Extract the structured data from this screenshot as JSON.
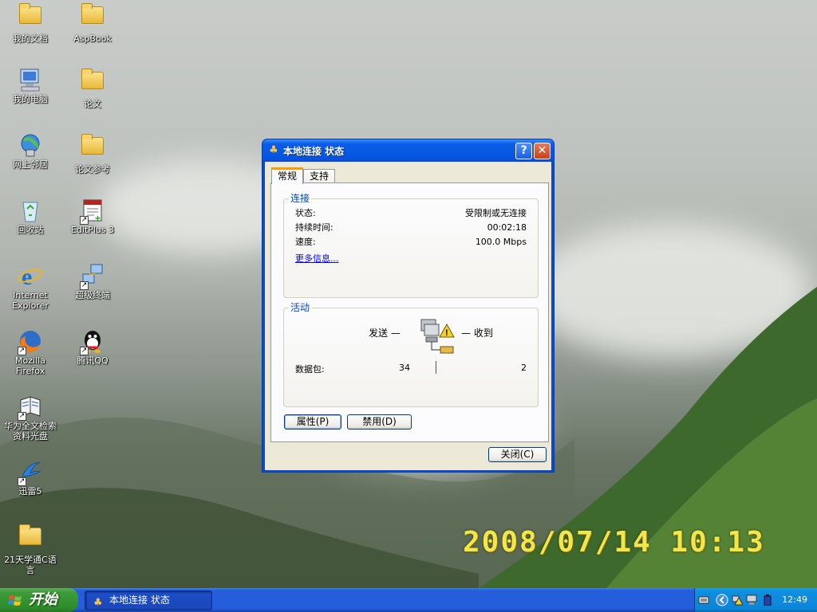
{
  "desktop": {
    "icons": [
      {
        "label": "我的文档",
        "icon": "my-documents-icon"
      },
      {
        "label": "AspBook",
        "icon": "folder-icon"
      },
      {
        "label": "我的电脑",
        "icon": "my-computer-icon"
      },
      {
        "label": "论文",
        "icon": "folder-icon"
      },
      {
        "label": "网上邻居",
        "icon": "network-places-icon"
      },
      {
        "label": "论文参考",
        "icon": "folder-icon"
      },
      {
        "label": "回收站",
        "icon": "recycle-bin-icon"
      },
      {
        "label": "EditPlus 3",
        "icon": "editplus-icon"
      },
      {
        "label": "Internet\nExplorer",
        "icon": "internet-explorer-icon"
      },
      {
        "label": "超级终端",
        "icon": "hyperterminal-icon"
      },
      {
        "label": "Mozilla\nFirefox",
        "icon": "firefox-icon"
      },
      {
        "label": "腾讯QQ",
        "icon": "qq-icon"
      },
      {
        "label": "华为全文检索\n资料光盘",
        "icon": "book-icon"
      },
      {
        "label": "迅雷5",
        "icon": "thunder-icon"
      },
      {
        "label": "21天学通C语\n言",
        "icon": "folder-icon"
      }
    ],
    "date_stamp": "2008/07/14 10:13"
  },
  "window": {
    "title": "本地连接 状态",
    "title_icon": "network-connection-icon",
    "help_label": "?",
    "close_label": "✕",
    "tabs": [
      {
        "label": "常规",
        "active": true
      },
      {
        "label": "支持",
        "active": false
      }
    ],
    "connection": {
      "group_title": "连接",
      "rows": [
        {
          "label": "状态:",
          "value": "受限制或无连接"
        },
        {
          "label": "持续时间:",
          "value": "00:02:18"
        },
        {
          "label": "速度:",
          "value": "100.0 Mbps"
        }
      ],
      "more_info": "更多信息..."
    },
    "activity": {
      "group_title": "活动",
      "sent_label": "发送 —",
      "received_label": "— 收到",
      "packets_label": "数据包:",
      "packets_sent": "34",
      "packets_received": "2"
    },
    "buttons": {
      "properties": "属性(P)",
      "disable": "禁用(D)",
      "close": "关闭(C)"
    }
  },
  "taskbar": {
    "start_label": "开始",
    "task_button_label": "本地连接 状态",
    "clock": "12:49",
    "tray_icons": [
      "keyboard-icon",
      "show-hidden-icon",
      "network-warning-icon",
      "network-icon",
      "battery-icon"
    ]
  },
  "colors": {
    "title_blue": "#0a5de8",
    "start_green": "#3c9b3a",
    "group_title_blue": "#0046d5",
    "date_stamp_yellow": "#f1e74a"
  }
}
